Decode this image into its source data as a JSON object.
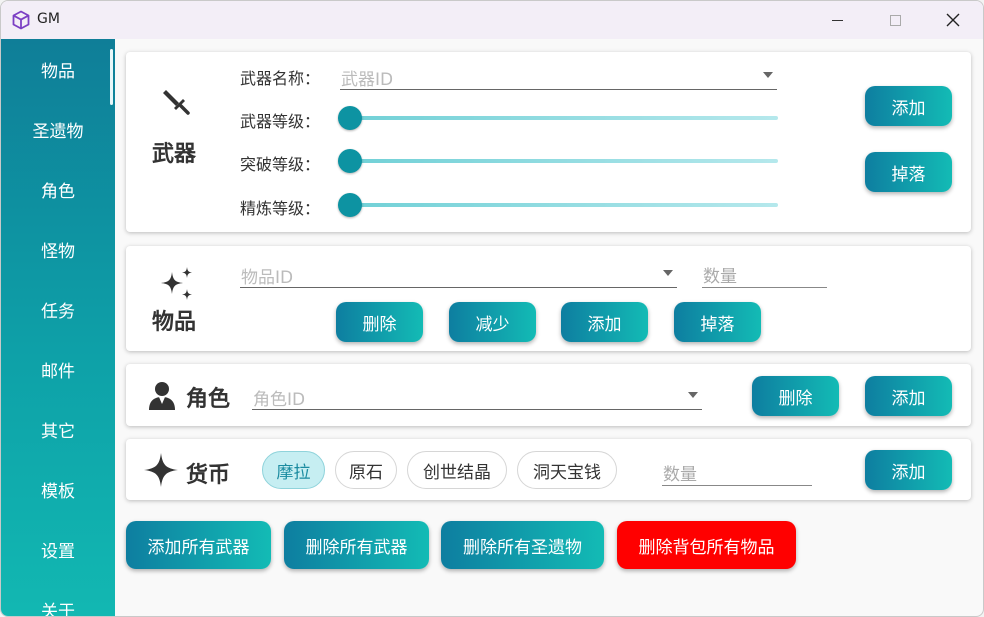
{
  "window": {
    "title": "GM",
    "colors": {
      "accent_start": "#0e7ea0",
      "accent_end": "#13bbb5",
      "danger": "#ff0000"
    }
  },
  "sidebar": {
    "items": [
      {
        "label": "物品",
        "active": true
      },
      {
        "label": "圣遗物"
      },
      {
        "label": "角色"
      },
      {
        "label": "怪物"
      },
      {
        "label": "任务"
      },
      {
        "label": "邮件"
      },
      {
        "label": "其它"
      },
      {
        "label": "模板"
      },
      {
        "label": "设置"
      },
      {
        "label": "关于"
      }
    ]
  },
  "weapon": {
    "icon": "sword-icon",
    "title": "武器",
    "name_label": "武器名称：",
    "name_placeholder": "武器ID",
    "level_label": "武器等级：",
    "level_value": 0,
    "breakthrough_label": "突破等级：",
    "breakthrough_value": 0,
    "refine_label": "精炼等级：",
    "refine_value": 0,
    "add_button": "添加",
    "drop_button": "掉落"
  },
  "item": {
    "icon": "sparkles-icon",
    "title": "物品",
    "id_placeholder": "物品ID",
    "quantity_placeholder": "数量",
    "buttons": {
      "delete": "删除",
      "reduce": "减少",
      "add": "添加",
      "drop": "掉落"
    }
  },
  "character": {
    "icon": "person-icon",
    "title": "角色",
    "id_placeholder": "角色ID",
    "delete_button": "删除",
    "add_button": "添加"
  },
  "currency": {
    "icon": "star-icon",
    "title": "货币",
    "options": [
      "摩拉",
      "原石",
      "创世结晶",
      "洞天宝钱"
    ],
    "selected": "摩拉",
    "quantity_placeholder": "数量",
    "add_button": "添加"
  },
  "bulk_actions": {
    "add_all_weapons": "添加所有武器",
    "delete_all_weapons": "删除所有武器",
    "delete_all_artifacts": "删除所有圣遗物",
    "delete_all_backpack": "删除背包所有物品"
  }
}
